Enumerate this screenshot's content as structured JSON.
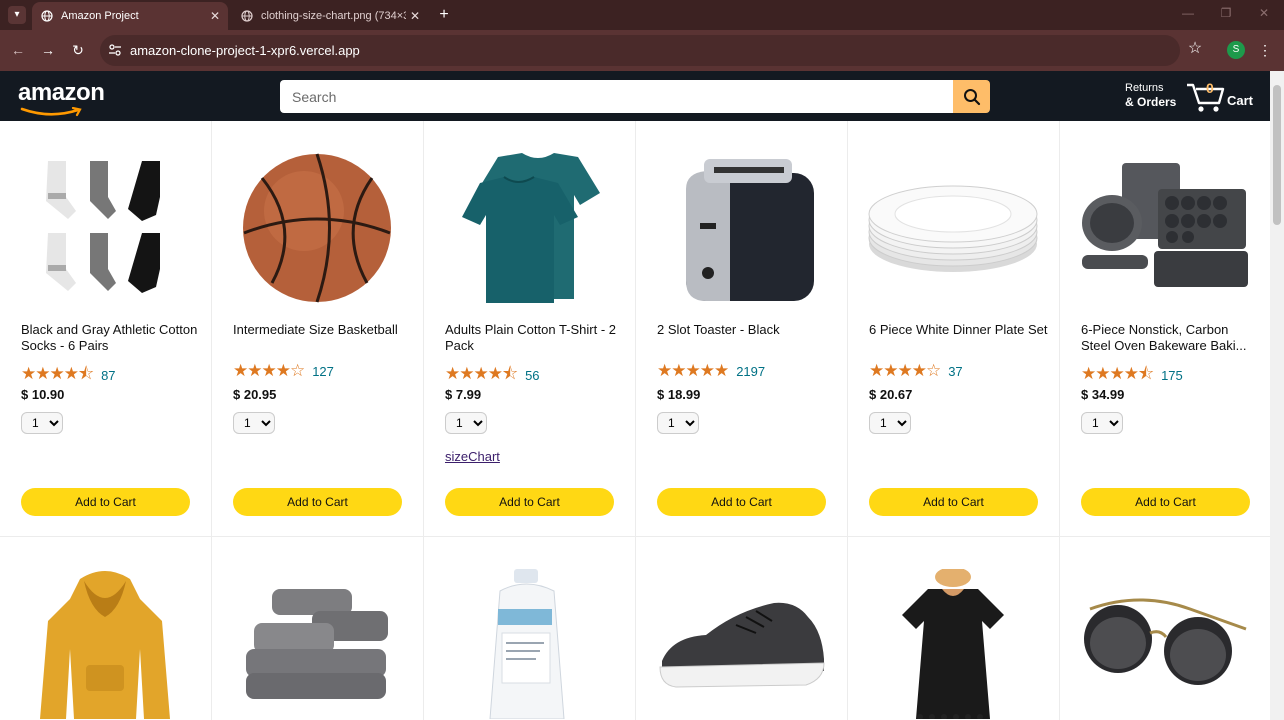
{
  "browser": {
    "tabs": [
      {
        "title": "Amazon Project",
        "active": true
      },
      {
        "title": "clothing-size-chart.png (734×3",
        "active": false
      }
    ],
    "url": "amazon-clone-project-1-xpr6.vercel.app",
    "profile_initial": "S"
  },
  "header": {
    "logo": "amazon",
    "search_placeholder": "Search",
    "returns_line1": "Returns",
    "returns_line2": "& Orders",
    "cart_count": "0",
    "cart_label": "Cart"
  },
  "colors": {
    "header_bg": "#131921",
    "search_button": "#febd69",
    "add_to_cart": "#ffd814",
    "star": "#de7921",
    "rating_link": "#007185"
  },
  "products": [
    {
      "name": "Black and Gray Athletic Cotton Socks - 6 Pairs",
      "stars": "★★★★⯪",
      "rating": 4.5,
      "count": "87",
      "price": "$ 10.90",
      "qty": "1",
      "image": "socks",
      "extra_link": ""
    },
    {
      "name": "Intermediate Size Basketball",
      "stars": "★★★★☆",
      "rating": 4,
      "count": "127",
      "price": "$ 20.95",
      "qty": "1",
      "image": "basketball",
      "extra_link": ""
    },
    {
      "name": "Adults Plain Cotton T-Shirt - 2 Pack",
      "stars": "★★★★⯪",
      "rating": 4.5,
      "count": "56",
      "price": "$ 7.99",
      "qty": "1",
      "image": "tshirt",
      "extra_link": "sizeChart"
    },
    {
      "name": "2 Slot Toaster - Black",
      "stars": "★★★★★",
      "rating": 5,
      "count": "2197",
      "price": "$ 18.99",
      "qty": "1",
      "image": "toaster",
      "extra_link": ""
    },
    {
      "name": "6 Piece White Dinner Plate Set",
      "stars": "★★★★☆",
      "rating": 4,
      "count": "37",
      "price": "$ 20.67",
      "qty": "1",
      "image": "plates",
      "extra_link": ""
    },
    {
      "name": "6-Piece Nonstick, Carbon Steel Oven Bakeware Baki...",
      "stars": "★★★★⯪",
      "rating": 4.5,
      "count": "175",
      "price": "$ 34.99",
      "qty": "1",
      "image": "bakeware",
      "extra_link": ""
    }
  ],
  "products_row2": [
    {
      "image": "hoodie"
    },
    {
      "image": "towels"
    },
    {
      "image": "detergent"
    },
    {
      "image": "sneaker"
    },
    {
      "image": "dress"
    },
    {
      "image": "sunglasses"
    }
  ],
  "add_to_cart_label": "Add to Cart"
}
